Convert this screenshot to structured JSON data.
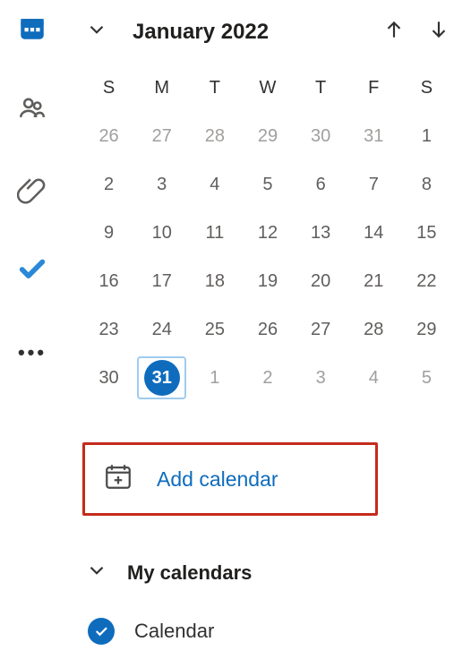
{
  "month_header": {
    "title": "January 2022"
  },
  "dow": [
    "S",
    "M",
    "T",
    "W",
    "T",
    "F",
    "S"
  ],
  "weeks": [
    [
      {
        "n": "26",
        "outside": true
      },
      {
        "n": "27",
        "outside": true
      },
      {
        "n": "28",
        "outside": true
      },
      {
        "n": "29",
        "outside": true
      },
      {
        "n": "30",
        "outside": true
      },
      {
        "n": "31",
        "outside": true
      },
      {
        "n": "1",
        "outside": false
      }
    ],
    [
      {
        "n": "2"
      },
      {
        "n": "3"
      },
      {
        "n": "4"
      },
      {
        "n": "5"
      },
      {
        "n": "6"
      },
      {
        "n": "7"
      },
      {
        "n": "8"
      }
    ],
    [
      {
        "n": "9"
      },
      {
        "n": "10"
      },
      {
        "n": "11"
      },
      {
        "n": "12"
      },
      {
        "n": "13"
      },
      {
        "n": "14"
      },
      {
        "n": "15"
      }
    ],
    [
      {
        "n": "16"
      },
      {
        "n": "17"
      },
      {
        "n": "18"
      },
      {
        "n": "19"
      },
      {
        "n": "20"
      },
      {
        "n": "21"
      },
      {
        "n": "22"
      }
    ],
    [
      {
        "n": "23"
      },
      {
        "n": "24"
      },
      {
        "n": "25"
      },
      {
        "n": "26"
      },
      {
        "n": "27"
      },
      {
        "n": "28"
      },
      {
        "n": "29"
      }
    ],
    [
      {
        "n": "30"
      },
      {
        "n": "31",
        "today": true
      },
      {
        "n": "1",
        "outside": true
      },
      {
        "n": "2",
        "outside": true
      },
      {
        "n": "3",
        "outside": true
      },
      {
        "n": "4",
        "outside": true
      },
      {
        "n": "5",
        "outside": true
      }
    ]
  ],
  "add_calendar_label": "Add calendar",
  "my_calendars_label": "My calendars",
  "calendars": [
    {
      "name": "Calendar",
      "checked": true,
      "color": "#0f6cbd"
    }
  ],
  "colors": {
    "accent": "#0f6cbd",
    "highlight_border": "#c42b1c"
  }
}
